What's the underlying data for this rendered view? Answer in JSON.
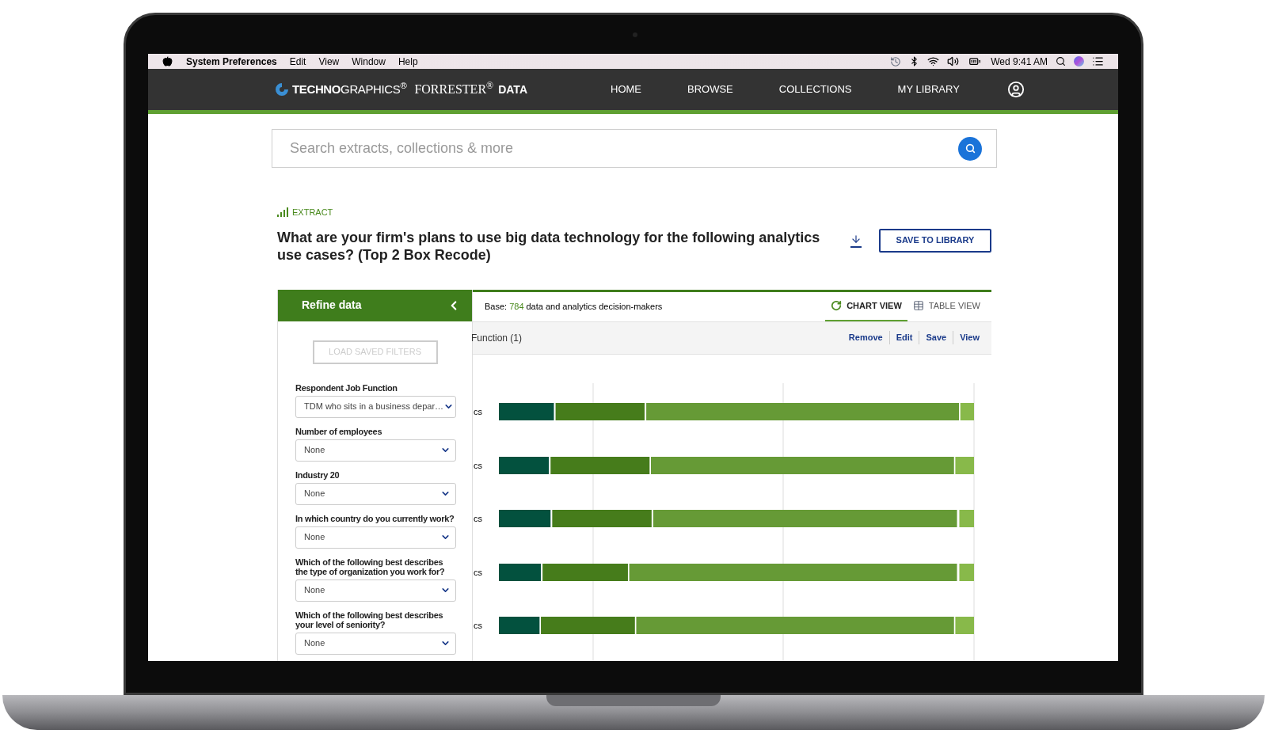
{
  "menubar": {
    "app": "System Preferences",
    "menus": [
      "Edit",
      "View",
      "Window",
      "Help"
    ],
    "clock": "Wed 9:41 AM"
  },
  "nav": {
    "product": "**TECHNO**GRAPHICS$^{®}$",
    "company": "FORRESTER$^{®}$",
    "suffix": "DATA",
    "items": [
      "HOME",
      "BROWSE",
      "COLLECTIONS",
      "MY LIBRARY"
    ]
  },
  "search": {
    "placeholder": "Search extracts, collections & more"
  },
  "extract": {
    "label": "EXTRACT",
    "title": "What are your firm's plans to use big data technology for the following analytics use cases? (Top 2 Box Recode)",
    "save_button": "SAVE TO LIBRARY"
  },
  "refine": {
    "title": "Refine data",
    "load_button": {
      "label": "LOAD SAVED FILTERS",
      "disabled": true
    },
    "filters": [
      {
        "label": "Respondent Job Function",
        "value": "TDM who sits in a business depar…"
      },
      {
        "label": "Number of employees",
        "value": "None"
      },
      {
        "label": "Industry 20",
        "value": "None"
      },
      {
        "label": "In which country do you currently work?",
        "value": "None"
      },
      {
        "label": "Which of the following best describes the type of organization you work for?",
        "value": "None"
      },
      {
        "label": "Which of the following best describes your level of seniority?",
        "value": "None"
      }
    ]
  },
  "view": {
    "base_label": "Base:",
    "base_count": "784",
    "base_text": "data and analytics decision-makers",
    "tabs": [
      {
        "label": "CHART VIEW",
        "kind": "chart",
        "selected": true
      },
      {
        "label": "TABLE VIEW",
        "kind": "table",
        "selected": false
      }
    ],
    "filter": "Function (1)",
    "actions": [
      "Remove",
      "Edit",
      "Save",
      "View"
    ],
    "row_labels": [
      "cs",
      "cs",
      "cs",
      "cs",
      "cs"
    ]
  }
}
